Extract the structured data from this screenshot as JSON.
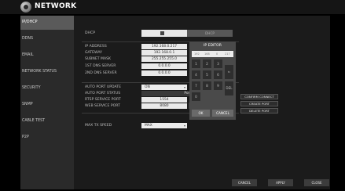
{
  "header": {
    "title": "NETWORK",
    "logo_icon": "camera-logo-icon"
  },
  "sidebar": {
    "items": [
      {
        "label": "IP/DHCP",
        "active": true
      },
      {
        "label": "DDNS",
        "active": false
      },
      {
        "label": "EMAIL",
        "active": false
      },
      {
        "label": "NETWORK STATUS",
        "active": false
      },
      {
        "label": "SECURITY",
        "active": false
      },
      {
        "label": "SNMP",
        "active": false
      },
      {
        "label": "CABLE TEST",
        "active": false
      },
      {
        "label": "P2P",
        "active": false
      }
    ]
  },
  "form": {
    "dhcp_label": "DHCP",
    "dhcp_right_text": "DHCP",
    "ip_address_label": "IP ADDRESS",
    "ip_address_value": "192.168.0.217",
    "gateway_label": "GATEWAY",
    "gateway_value": "192.168.0.1",
    "subnet_mask_label": "SUBNET MASK",
    "subnet_mask_value": "255.255.255.0",
    "dns1_label": "1ST DNS SERVER",
    "dns1_value": "0.0.0.0",
    "dns2_label": "2ND DNS SERVER",
    "dns2_value": "0.0.0.0",
    "auto_port_update_label": "AUTO PORT UPDATE",
    "auto_port_update_value": "ON",
    "auto_port_status_label": "AUTO PORT STATUS",
    "auto_port_status_value": "Port up",
    "rtsp_label": "RTSP SERVICE PORT",
    "rtsp_value": "1554",
    "web_label": "WEB SERVICE PORT",
    "web_value": "8080",
    "auto_port_forwarding_label": "AUTO PORT FORWARDING",
    "confirm_connect_label": "CONFIRM CONNECT",
    "create_port_label": "CREATE PORT",
    "delete_port_label": "DELETE PORT",
    "max_tx_speed_label": "MAX TX SPEED",
    "max_tx_speed_value": "MAX"
  },
  "ip_editor": {
    "title": "IP EDITOR",
    "seg1": "192",
    "seg2": "168",
    "seg3": "0",
    "seg4": "217",
    "keys": [
      "1",
      "2",
      "3",
      "4",
      "5",
      "6",
      "7",
      "8",
      "9",
      "0"
    ],
    "backspace_icon": "backspace-arrow-icon",
    "del_label": "DEL",
    "ok_label": "OK",
    "cancel_label": "CANCEL"
  },
  "footer": {
    "cancel_label": "CANCEL",
    "apply_label": "APPLY",
    "close_label": "CLOSE"
  }
}
